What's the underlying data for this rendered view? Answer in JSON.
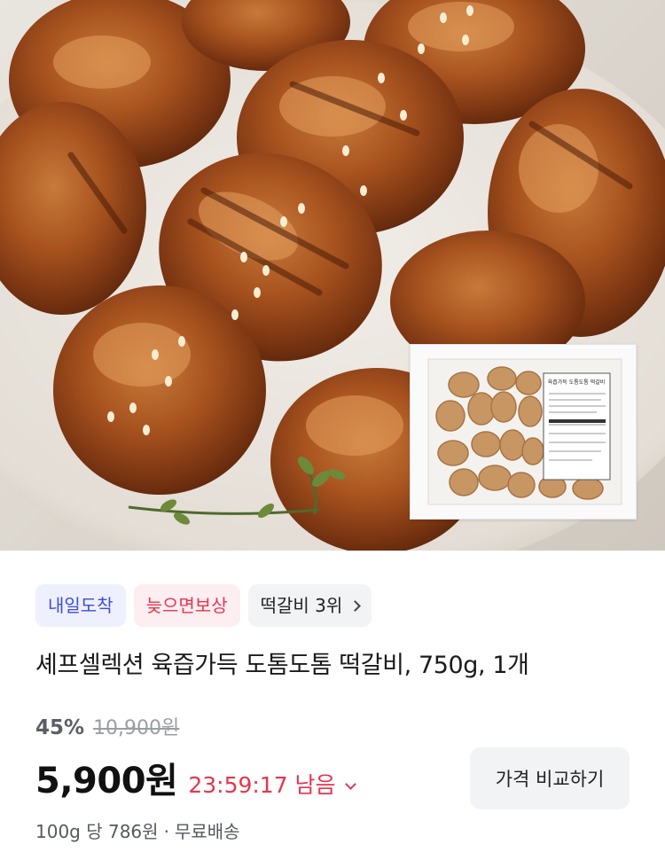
{
  "hero": {
    "package_label_text": "육즙가득 도톰도톰 떡갈비"
  },
  "badges": [
    {
      "label": "내일도착",
      "color": "#3d4fd1"
    },
    {
      "label": "늦으면보상",
      "color": "#e8344e"
    },
    {
      "label": "떡갈비 3위"
    }
  ],
  "product": {
    "title": "셰프셀렉션 육즙가득 도톰도톰 떡갈비, 750g, 1개",
    "discount_rate": "45%",
    "original_price": "10,900원",
    "sale_price": "5,900원",
    "timer": "23:59:17 남음",
    "compare_button": "가격 비교하기",
    "unit_price": "100g 당 786원",
    "separator": "·",
    "shipping": "무료배송"
  },
  "icons": {
    "rank_chevron": "chevron-right-icon",
    "timer_chevron": "chevron-down-icon"
  },
  "colors": {
    "accent_red": "#e8344e",
    "accent_blue": "#3d4fd1"
  }
}
